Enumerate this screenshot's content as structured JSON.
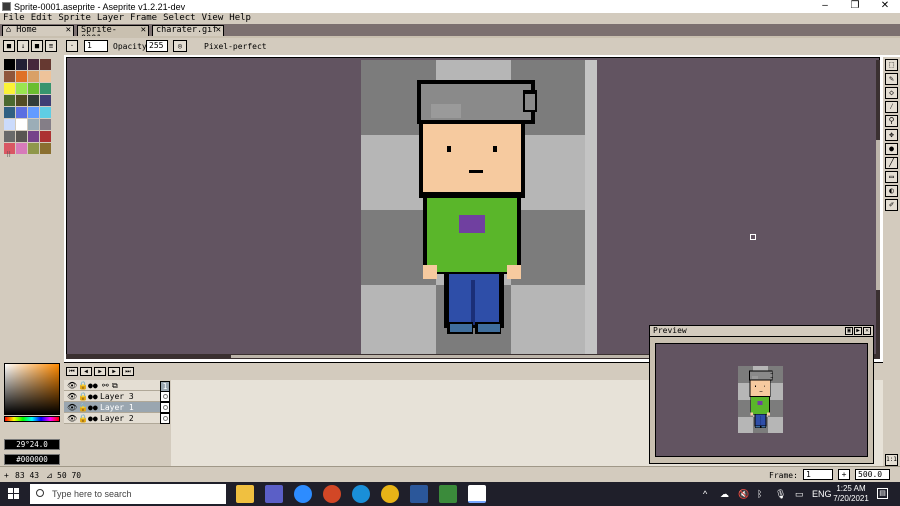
{
  "window": {
    "title": "Sprite-0001.aseprite - Aseprite v1.2.21-dev",
    "minimize": "–",
    "maximize": "❐",
    "close": "✕"
  },
  "menu": [
    "File",
    "Edit",
    "Sprite",
    "Layer",
    "Frame",
    "Select",
    "View",
    "Help"
  ],
  "tabs": [
    {
      "label": "Home",
      "icon": "home-icon",
      "active": false
    },
    {
      "label": "Sprite-0001.ase",
      "active": true
    },
    {
      "label": "charater.gif",
      "active": false
    }
  ],
  "context_bar": {
    "brush_size": "1",
    "opacity_label": "Opacity:",
    "opacity_value": "255",
    "pixel_perfect_label": "Pixel-perfect"
  },
  "palette": [
    "#000000",
    "#222034",
    "#45283c",
    "#663931",
    "#8f563b",
    "#df7126",
    "#d9a066",
    "#eec39a",
    "#fbf236",
    "#99e550",
    "#6abe30",
    "#37946e",
    "#4b692f",
    "#524b24",
    "#323c39",
    "#3f3f74",
    "#306082",
    "#5b6ee1",
    "#639bff",
    "#5fcde4",
    "#cbdbfc",
    "#ffffff",
    "#9badb7",
    "#847e87",
    "#696a6a",
    "#595652",
    "#76428a",
    "#ac3232",
    "#d95763",
    "#d77bba",
    "#8f974a",
    "#8a6f30"
  ],
  "palette_extra": "⠿",
  "color_picker": {
    "fg_color_text": "29°24.0",
    "bg_color_text": "#000000"
  },
  "timeline": {
    "buttons": [
      "⏮",
      "◀",
      "▶",
      "▶",
      "⏭"
    ],
    "frame_number": "1",
    "layers": [
      {
        "name": "Layer 3",
        "selected": false
      },
      {
        "name": "Layer 1",
        "selected": true
      },
      {
        "name": "Layer 2",
        "selected": false
      }
    ]
  },
  "preview": {
    "title": "Preview"
  },
  "status": {
    "cursor_pos": "83 43",
    "selection_size": "50 70",
    "frame_label": "Frame:",
    "frame_value": "1",
    "zoom_value": "500.0",
    "ratio_label": "1:1"
  },
  "taskbar": {
    "search_placeholder": "Type here to search",
    "lang": "ENG",
    "time": "1:25 AM",
    "date": "7/20/2021"
  },
  "tools": [
    "marquee",
    "pencil",
    "eraser",
    "eyedropper",
    "zoom",
    "move",
    "paint-bucket",
    "line",
    "rectangle",
    "blob",
    "blur"
  ],
  "colors": {
    "workspace": "#625461",
    "panel": "#d3cbbe",
    "checker_dark": "#7c7c7c",
    "checker_light": "#b6b6b6",
    "hair": "#8a8a8a",
    "skin": "#f6ca9f",
    "shirt": "#5ab62a",
    "pants": "#2e4ea8",
    "logo": "#7040a0"
  }
}
